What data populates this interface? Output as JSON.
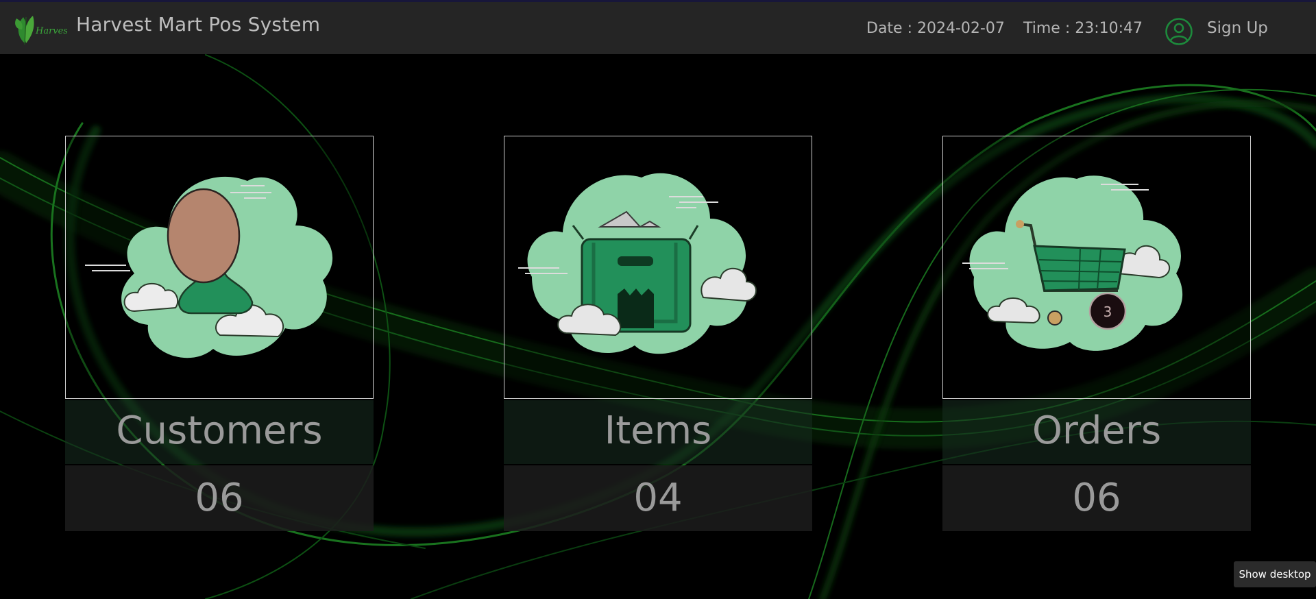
{
  "header": {
    "title": "Harvest Mart Pos System",
    "logo_text": "Harvest",
    "date": "Date : 2024-02-07",
    "time": "Time : 23:10:47",
    "signup_label": "Sign Up",
    "user_icon": "user-circle-icon"
  },
  "colors": {
    "accent_green": "#1d8a3c",
    "navbar_bg": "#252525",
    "background": "#000000"
  },
  "cards": [
    {
      "label": "Customers",
      "count": "06",
      "icon": "customer-icon"
    },
    {
      "label": "Items",
      "count": "04",
      "icon": "item-box-icon"
    },
    {
      "label": "Orders",
      "count": "06",
      "icon": "shopping-cart-icon"
    }
  ],
  "taskbar": {
    "tooltip": "Show desktop"
  }
}
